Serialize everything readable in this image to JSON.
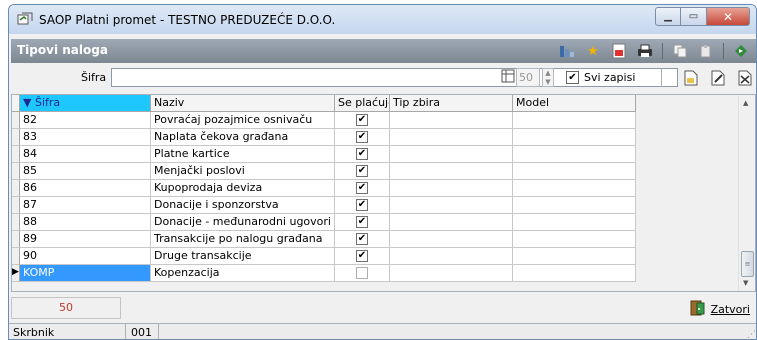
{
  "window": {
    "title": "SAOP Platni promet - TESTNO PREDUZEĆE D.O.O.",
    "min_label": "▁",
    "max_label": "▭",
    "close_label": "✕"
  },
  "panel": {
    "title": "Tipovi naloga"
  },
  "filter": {
    "sifra_label": "Šifra",
    "sifra_value": "",
    "record_count": "50",
    "svi_zapisi_label": "Svi zapisi",
    "svi_zapisi_checked": true
  },
  "grid": {
    "columns": [
      "Šifra",
      "Naziv",
      "Se plaćuje",
      "Tip zbira",
      "Model"
    ],
    "sort_indicator": "▼",
    "rows": [
      {
        "sifra": "82",
        "naziv": "Povraćaj pozajmice osnivaču",
        "se_placuje": true,
        "tip_zbira": "",
        "model": ""
      },
      {
        "sifra": "83",
        "naziv": "Naplata čekova građana",
        "se_placuje": true,
        "tip_zbira": "",
        "model": ""
      },
      {
        "sifra": "84",
        "naziv": "Platne kartice",
        "se_placuje": true,
        "tip_zbira": "",
        "model": ""
      },
      {
        "sifra": "85",
        "naziv": "Menjački poslovi",
        "se_placuje": true,
        "tip_zbira": "",
        "model": ""
      },
      {
        "sifra": "86",
        "naziv": "Kupoprodaja deviza",
        "se_placuje": true,
        "tip_zbira": "",
        "model": ""
      },
      {
        "sifra": "87",
        "naziv": "Donacije i sponzorstva",
        "se_placuje": true,
        "tip_zbira": "",
        "model": ""
      },
      {
        "sifra": "88",
        "naziv": "Donacije - međunarodni ugovori",
        "se_placuje": true,
        "tip_zbira": "",
        "model": ""
      },
      {
        "sifra": "89",
        "naziv": "Transakcije po nalogu građana",
        "se_placuje": true,
        "tip_zbira": "",
        "model": ""
      },
      {
        "sifra": "90",
        "naziv": "Druge transakcije",
        "se_placuje": true,
        "tip_zbira": "",
        "model": ""
      },
      {
        "sifra": "KOMP",
        "naziv": "Kopenzacija",
        "se_placuje": false,
        "tip_zbira": "",
        "model": "",
        "selected": true
      }
    ]
  },
  "footer": {
    "count": "50",
    "close_label": "Zatvori"
  },
  "statusbar": {
    "user": "Skrbnik",
    "code": "001"
  },
  "colors": {
    "sort_header": "#1ec8ff",
    "selection": "#3399ff",
    "panel_bar": "#8a949f",
    "count_text": "#c0392b"
  },
  "icons": [
    "app-icon",
    "filter-icon",
    "star-icon",
    "export-icon",
    "print-icon",
    "copy-icon",
    "paste-icon",
    "exit-icon",
    "new-record-icon",
    "edit-record-icon",
    "delete-record-icon",
    "close-icon"
  ]
}
